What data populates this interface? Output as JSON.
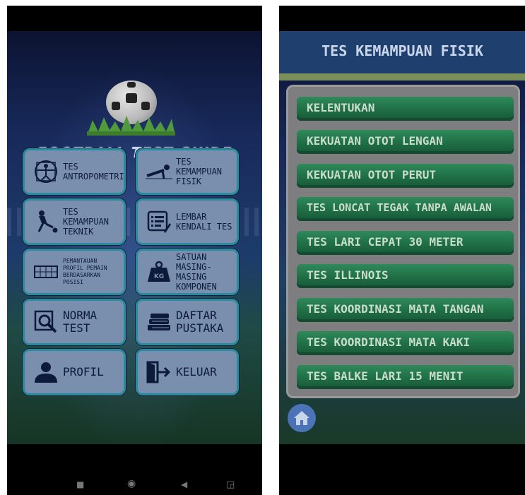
{
  "left": {
    "app_title": "FOOTBALL TEST GUIDE",
    "tiles": [
      {
        "name": "tes-antropometri-tile",
        "icon": "vitruvian-man-icon",
        "lines": [
          "TES",
          "ANTROPOMETRI"
        ]
      },
      {
        "name": "tes-kemampuan-fisik-tile",
        "icon": "push-up-icon",
        "lines": [
          "TES",
          "KEMAMPUAN",
          "FISIK"
        ]
      },
      {
        "name": "tes-kemampuan-teknik-tile",
        "icon": "kick-ball-icon",
        "lines": [
          "TES",
          "KEMAMPUAN",
          "TEKNIK"
        ]
      },
      {
        "name": "lembar-kendali-tes-tile",
        "icon": "checklist-icon",
        "lines": [
          "LEMBAR",
          "KENDALI TES"
        ]
      },
      {
        "name": "pemantauan-profil-tile",
        "icon": "goal-net-icon",
        "lines": [
          "PEMANTAUAN",
          "PROFIL PEMAIN",
          "BERDASARKAN",
          "POSISI"
        ]
      },
      {
        "name": "satuan-komponen-tile",
        "icon": "kg-weight-icon",
        "lines": [
          "SATUAN",
          "MASING-MASING",
          "KOMPONEN"
        ]
      },
      {
        "name": "norma-test-tile",
        "icon": "magnifier-icon",
        "lines": [
          "NORMA",
          "TEST"
        ]
      },
      {
        "name": "daftar-pustaka-tile",
        "icon": "books-icon",
        "lines": [
          "DAFTAR",
          "PUSTAKA"
        ]
      },
      {
        "name": "profil-tile",
        "icon": "user-icon",
        "lines": [
          "PROFIL"
        ]
      },
      {
        "name": "keluar-tile",
        "icon": "exit-door-icon",
        "lines": [
          "KELUAR"
        ]
      }
    ],
    "nav": {
      "recents": "■",
      "home": "◉",
      "back": "◀",
      "screen": "◲"
    }
  },
  "right": {
    "title": "TES KEMAMPUAN FISIK",
    "items": [
      "KELENTUKAN",
      "KEKUATAN OTOT LENGAN",
      "KEKUATAN OTOT PERUT",
      "TES LONCAT TEGAK TANPA AWALAN",
      "TES LARI CEPAT 30 METER",
      "TES ILLINOIS",
      "TES KOORDINASI MATA TANGAN",
      "TES KOORDINASI MATA KAKI",
      "TES BALKE LARI 15 MENIT"
    ],
    "home_icon": "home-icon"
  }
}
